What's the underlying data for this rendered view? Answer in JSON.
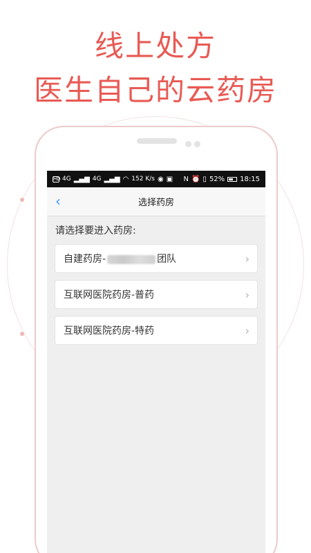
{
  "promo": {
    "line1": "线上处方",
    "line2": "医生自己的云药房"
  },
  "status_bar": {
    "left": [
      "HD",
      "4G",
      "4G",
      "152",
      "K/s"
    ],
    "battery": "52%",
    "time": "18:15"
  },
  "nav": {
    "back_icon": "chevron-left-icon",
    "title": "选择药房"
  },
  "prompt": "请选择要进入药房:",
  "pharmacies": [
    {
      "prefix": "自建药房-",
      "suffix": "团队",
      "redacted": true
    },
    {
      "prefix": "互联网医院药房-普药",
      "suffix": "",
      "redacted": false
    },
    {
      "prefix": "互联网医院药房-特药",
      "suffix": "",
      "redacted": false
    }
  ],
  "colors": {
    "promo_red": "#e85a54",
    "accent_blue": "#3a95ff",
    "phone_border": "#eccaca",
    "screen_bg": "#efefef"
  }
}
